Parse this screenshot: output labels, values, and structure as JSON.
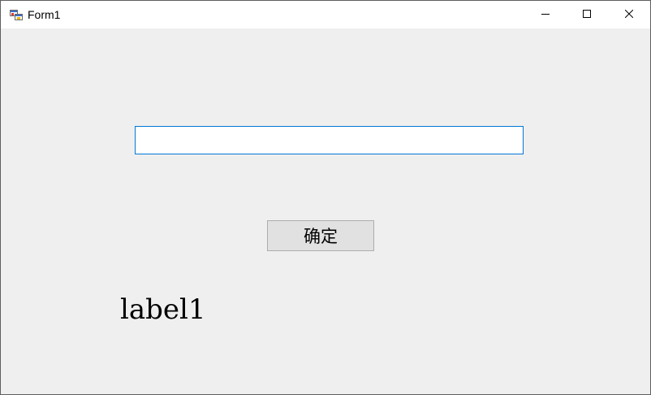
{
  "window": {
    "title": "Form1",
    "app_icon": "winforms-app-icon",
    "controls": {
      "minimize_icon": "minimize-icon",
      "maximize_icon": "maximize-icon",
      "close_icon": "close-icon"
    }
  },
  "form": {
    "textbox_value": "",
    "textbox_placeholder": "",
    "ok_button_label": "确定",
    "label_text": "label1"
  },
  "colors": {
    "client_background": "#efefef",
    "titlebar_background": "#ffffff",
    "textbox_focus_border": "#0078d7",
    "button_background": "#e1e1e1",
    "button_border": "#adadad"
  }
}
